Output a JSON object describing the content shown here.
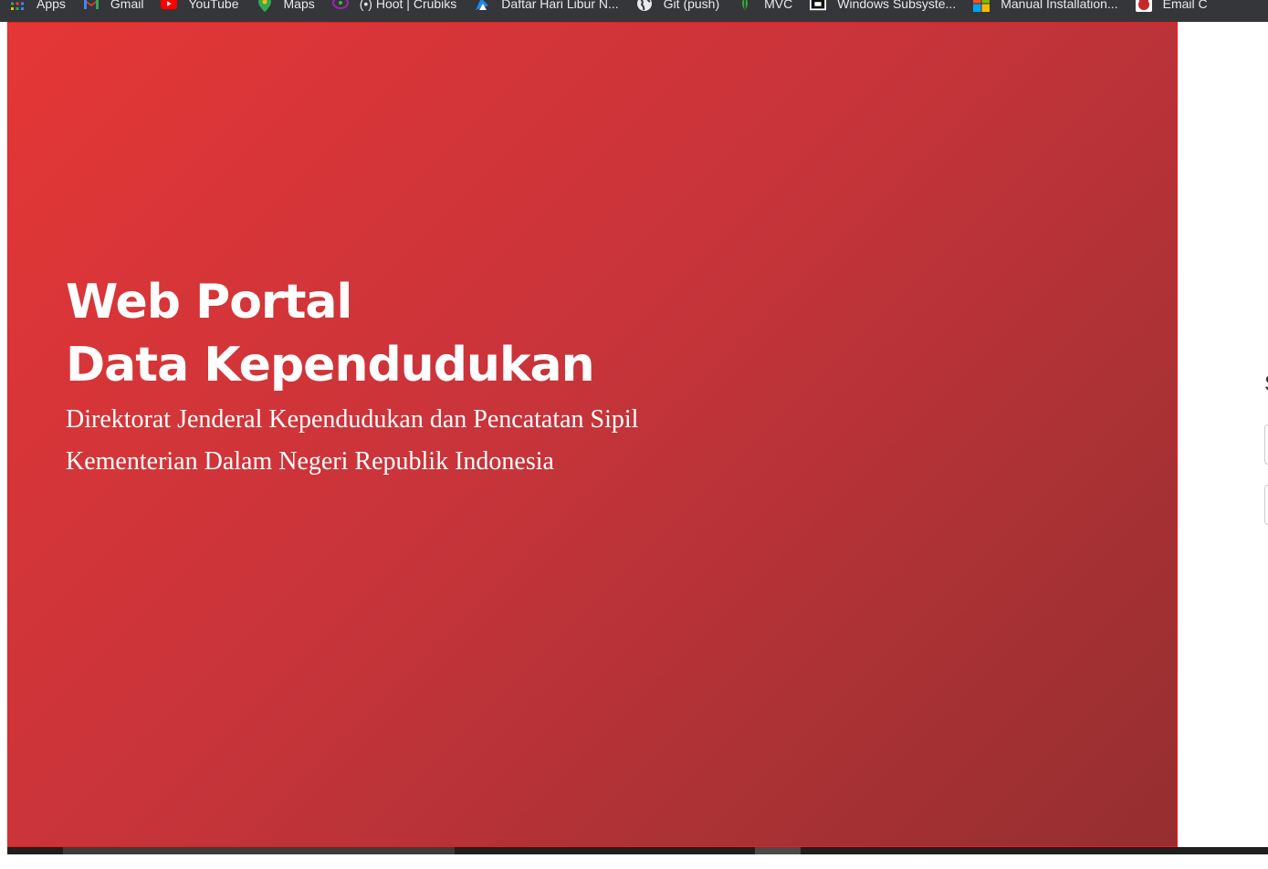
{
  "bookmarks": [
    {
      "label": "Apps",
      "icon": "apps-grid-icon"
    },
    {
      "label": "Gmail",
      "icon": "gmail-icon"
    },
    {
      "label": "YouTube",
      "icon": "youtube-icon"
    },
    {
      "label": "Maps",
      "icon": "maps-pin-icon"
    },
    {
      "label": "(•) Hoot | Crubiks",
      "icon": "hoot-icon"
    },
    {
      "label": "Daftar Hari Libur N...",
      "icon": "calendar-flag-icon"
    },
    {
      "label": "Git (push)",
      "icon": "globe-icon"
    },
    {
      "label": "MVC",
      "icon": "mvc-icon"
    },
    {
      "label": "Windows Subsyste...",
      "icon": "terminal-icon"
    },
    {
      "label": "Manual Installation...",
      "icon": "windows-logo-icon"
    },
    {
      "label": "Email C",
      "icon": "email-app-icon"
    }
  ],
  "hero": {
    "title_line1": "Web Portal",
    "title_line2": "Data Kependudukan",
    "subtitle_line1": "Direktorat Jenderal Kependudukan dan Pencatatan Sipil",
    "subtitle_line2": "Kementerian Dalam Negeri Republik Indonesia"
  },
  "right_panel": {
    "cut_heading": "S"
  },
  "colors": {
    "bookmark_bar_bg": "#35363a",
    "hero_gradient_start": "#e53636",
    "hero_gradient_end": "#962e30",
    "hero_border": "#ff1414"
  }
}
